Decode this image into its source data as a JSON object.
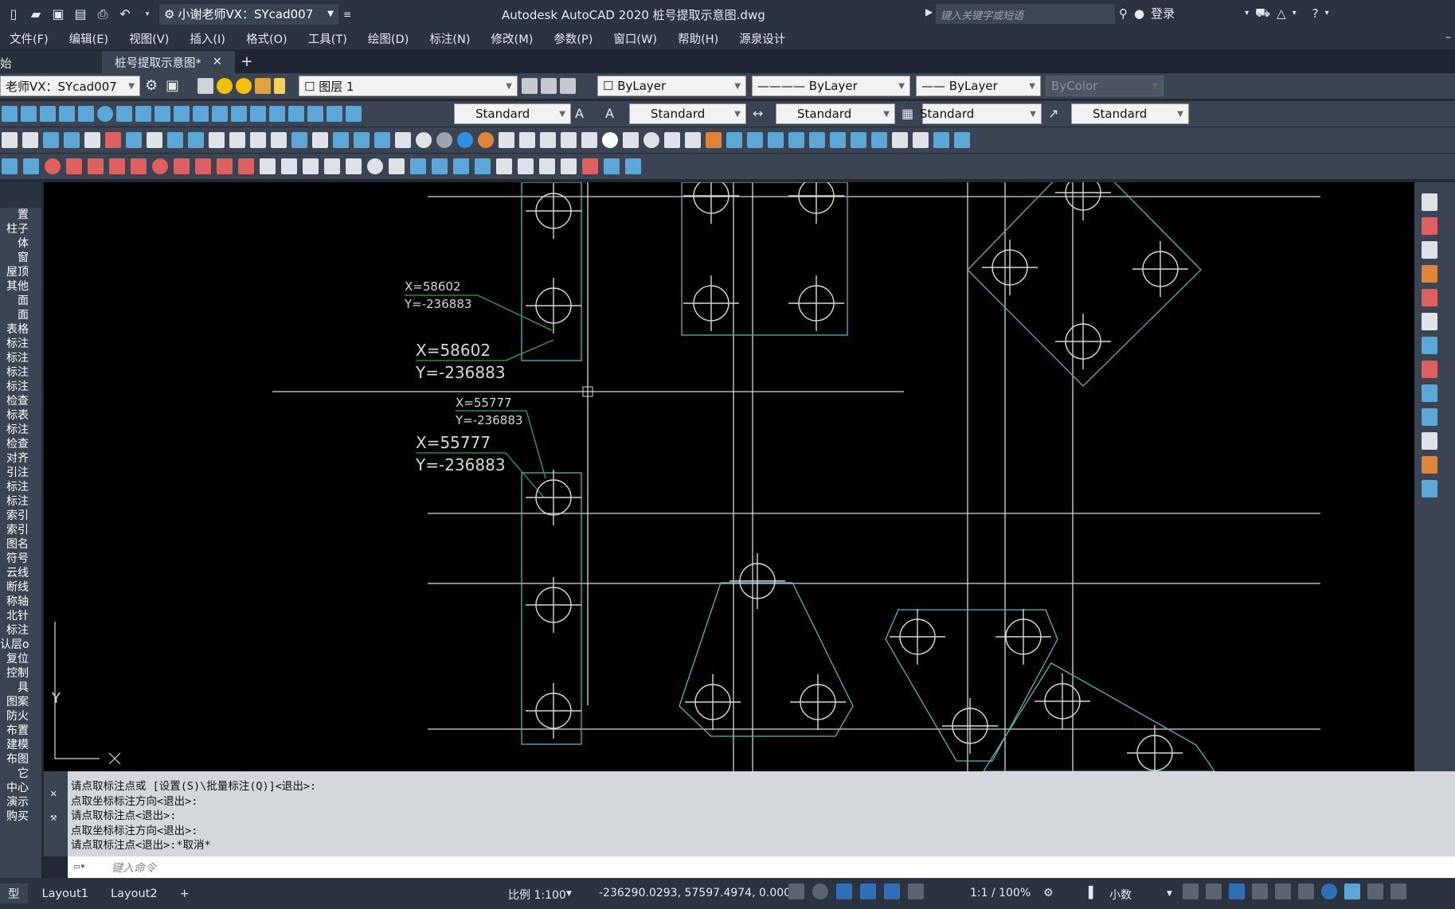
{
  "titlebar": {
    "workspace": "小谢老师VX：SYcad007",
    "title": "Autodesk AutoCAD 2020    桩号提取示意图.dwg",
    "search_placeholder": "键入关键字或短语",
    "login": "登录"
  },
  "menu": [
    "文件(F)",
    "编辑(E)",
    "视图(V)",
    "插入(I)",
    "格式(O)",
    "工具(T)",
    "绘图(D)",
    "标注(N)",
    "修改(M)",
    "参数(P)",
    "窗口(W)",
    "帮助(H)",
    "源泉设计"
  ],
  "tabs": {
    "start": "始",
    "file": "桩号提取示意图*",
    "close": "✕",
    "add": "+"
  },
  "toolbar1": {
    "workspace": "老师VX：SYcad007",
    "layer": "图层 1",
    "color": "ByLayer",
    "linetype": "ByLayer",
    "lineweight": "ByLayer",
    "plotstyle": "ByColor"
  },
  "toolbar2": {
    "textstyle": "Standard",
    "text2": "Standard",
    "dimstyle": "Standard",
    "tablestyle": "Standard",
    "mleader": "Standard"
  },
  "leftpanel": [
    "置",
    "柱子",
    "体",
    "窗",
    "屋顶",
    "其他",
    "面",
    "面",
    "表格",
    "标注",
    "标注",
    "标注",
    "标注",
    "检查",
    "标表",
    "标注",
    "检查",
    "对齐",
    "引注",
    "标注",
    "标注",
    "索引",
    "索引",
    "图名",
    "符号",
    "云线",
    "断线",
    "称轴",
    "北针",
    "标注",
    "认层o",
    "复位",
    "控制",
    "具",
    "图案",
    "防火",
    "布置",
    "建模",
    "布图",
    "它",
    "中心",
    "演示",
    "购买"
  ],
  "drawing": {
    "labels": [
      {
        "x": "X=58602",
        "y": "Y=-236883",
        "size": "small"
      },
      {
        "x": "X=58602",
        "y": "Y=-236883",
        "size": "large"
      },
      {
        "x": "X=55777",
        "y": "Y=-236883",
        "size": "small"
      },
      {
        "x": "X=55777",
        "y": "Y=-236883",
        "size": "large"
      }
    ],
    "ucs_y": "Y",
    "ucs_x": "X"
  },
  "command": {
    "lines": [
      "请点取标注点或 [设置(S)\\批量标注(Q)]<退出>:",
      "点取坐标标注方向<退出>:",
      "请点取标注点<退出>:",
      "点取坐标标注方向<退出>:",
      "请点取标注点<退出>:*取消*"
    ],
    "input_placeholder": "键入命令"
  },
  "status": {
    "model": "型",
    "layout1": "Layout1",
    "layout2": "Layout2",
    "add": "+",
    "scale": "比例 1:100",
    "coords": "-236290.0293, 57597.4974, 0.0000",
    "annoscale": "1:1 / 100%",
    "units": "小数"
  },
  "colors": {
    "canvas": "#000000",
    "cyan": "#4fb8b8",
    "green": "#2ea84a",
    "white": "#d8d8d8",
    "panel": "#3b4452"
  }
}
